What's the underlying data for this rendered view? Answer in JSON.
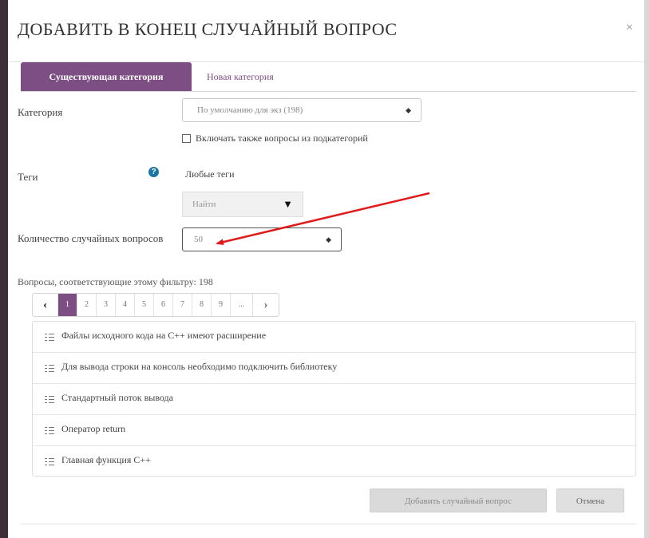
{
  "dialog": {
    "title": "ДОБАВИТЬ В КОНЕЦ СЛУЧАЙНЫЙ ВОПРОС",
    "close_glyph": "×"
  },
  "tabs": {
    "existing": "Существующая категория",
    "new": "Новая категория"
  },
  "form": {
    "category_label": "Категория",
    "category_value": "По умолчанию для экз (198)",
    "include_subcategories_label": "Включать также вопросы из подкатегорий",
    "include_subcategories_checked": false,
    "tags_label": "Теги",
    "help_glyph": "?",
    "tags_value": "Любые теги",
    "find_label": "Найти",
    "count_label": "Количество случайных вопросов",
    "count_value": "50"
  },
  "filter": {
    "matching_text": "Вопросы, соответствующие этому фильтру: 198"
  },
  "pagination": {
    "prev": "‹",
    "next": "›",
    "pages": [
      "1",
      "2",
      "3",
      "4",
      "5",
      "6",
      "7",
      "8",
      "9",
      "..."
    ],
    "active_page": "1"
  },
  "questions": [
    "Файлы исходного кода на C++ имеют расширение",
    "Для вывода строки на консоль необходимо подключить библиотеку",
    "Стандартный поток вывода",
    "Оператор return",
    "Главная функция C++"
  ],
  "buttons": {
    "add": "Добавить случайный вопрос",
    "cancel": "Отмена"
  },
  "colors": {
    "accent": "#7d4e84",
    "annotation_arrow": "#e11b1b",
    "help_icon": "#1a75a7"
  },
  "icons": {
    "question_type": "list-icon",
    "help": "question-circle-icon",
    "close": "close-icon"
  }
}
